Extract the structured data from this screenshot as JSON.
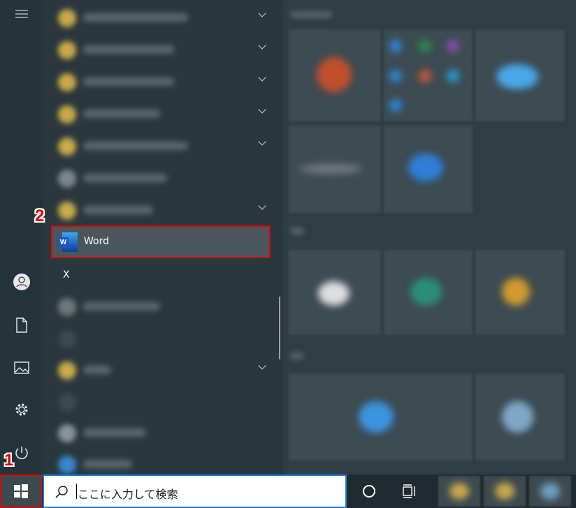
{
  "app_list": {
    "highlighted_app": "Word",
    "section_letter": "X",
    "word_icon_letter": "W"
  },
  "taskbar": {
    "search_placeholder": "ここに入力して検索"
  },
  "annotations": {
    "step1": "1",
    "step2": "2",
    "highlight_color": "#e00000"
  },
  "icons": {
    "menu": "hamburger-icon",
    "user": "user-icon",
    "documents": "document-icon",
    "pictures": "picture-icon",
    "settings": "gear-icon",
    "power": "power-icon",
    "start": "windows-logo-icon",
    "search": "search-icon",
    "cortana": "circle-icon",
    "task_view": "task-view-icon"
  },
  "colors": {
    "search_border": "#1a7fd4",
    "accent": "#0078d7"
  }
}
